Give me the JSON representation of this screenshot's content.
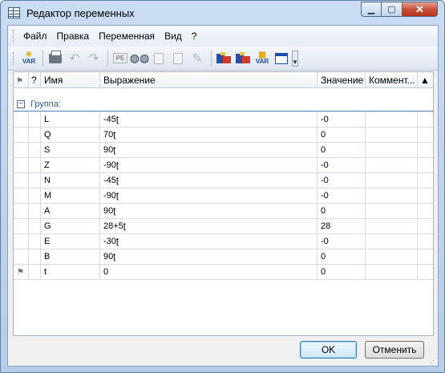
{
  "window": {
    "title": "Редактор переменных"
  },
  "menu": {
    "items": [
      "Файл",
      "Правка",
      "Переменная",
      "Вид",
      "?"
    ]
  },
  "toolbar": {
    "var_label": "VAR",
    "pe_label": "PE",
    "icons": [
      "new-variable-icon",
      "print-icon",
      "undo-icon",
      "redo-icon",
      "pe-icon",
      "find-icon",
      "copy-icon",
      "paste-icon",
      "wizard-icon",
      "export-icon",
      "import-icon",
      "new-var-icon",
      "window-icon",
      "more-icon"
    ]
  },
  "grid": {
    "columns": {
      "flag": "",
      "q": "?",
      "name": "Имя",
      "expr": "Выражение",
      "value": "Значение",
      "comment": "Коммент...",
      "warn": ""
    },
    "group_label": "Группа:",
    "rows": [
      {
        "name": "L",
        "expr": "-45ʈ",
        "value": "-0",
        "flag": ""
      },
      {
        "name": "Q",
        "expr": "70ʈ",
        "value": "0",
        "flag": ""
      },
      {
        "name": "S",
        "expr": "90ʈ",
        "value": "0",
        "flag": ""
      },
      {
        "name": "Z",
        "expr": "-90ʈ",
        "value": "-0",
        "flag": ""
      },
      {
        "name": "N",
        "expr": "-45ʈ",
        "value": "-0",
        "flag": ""
      },
      {
        "name": "M",
        "expr": "-90ʈ",
        "value": "-0",
        "flag": ""
      },
      {
        "name": "A",
        "expr": "90ʈ",
        "value": "0",
        "flag": ""
      },
      {
        "name": "G",
        "expr": "28+5ʈ",
        "value": "28",
        "flag": ""
      },
      {
        "name": "E",
        "expr": "-30ʈ",
        "value": "-0",
        "flag": ""
      },
      {
        "name": "B",
        "expr": "90ʈ",
        "value": "0",
        "flag": ""
      },
      {
        "name": "t",
        "expr": "0",
        "value": "0",
        "flag": "flag"
      }
    ]
  },
  "buttons": {
    "ok": "OK",
    "cancel": "Отменить"
  }
}
